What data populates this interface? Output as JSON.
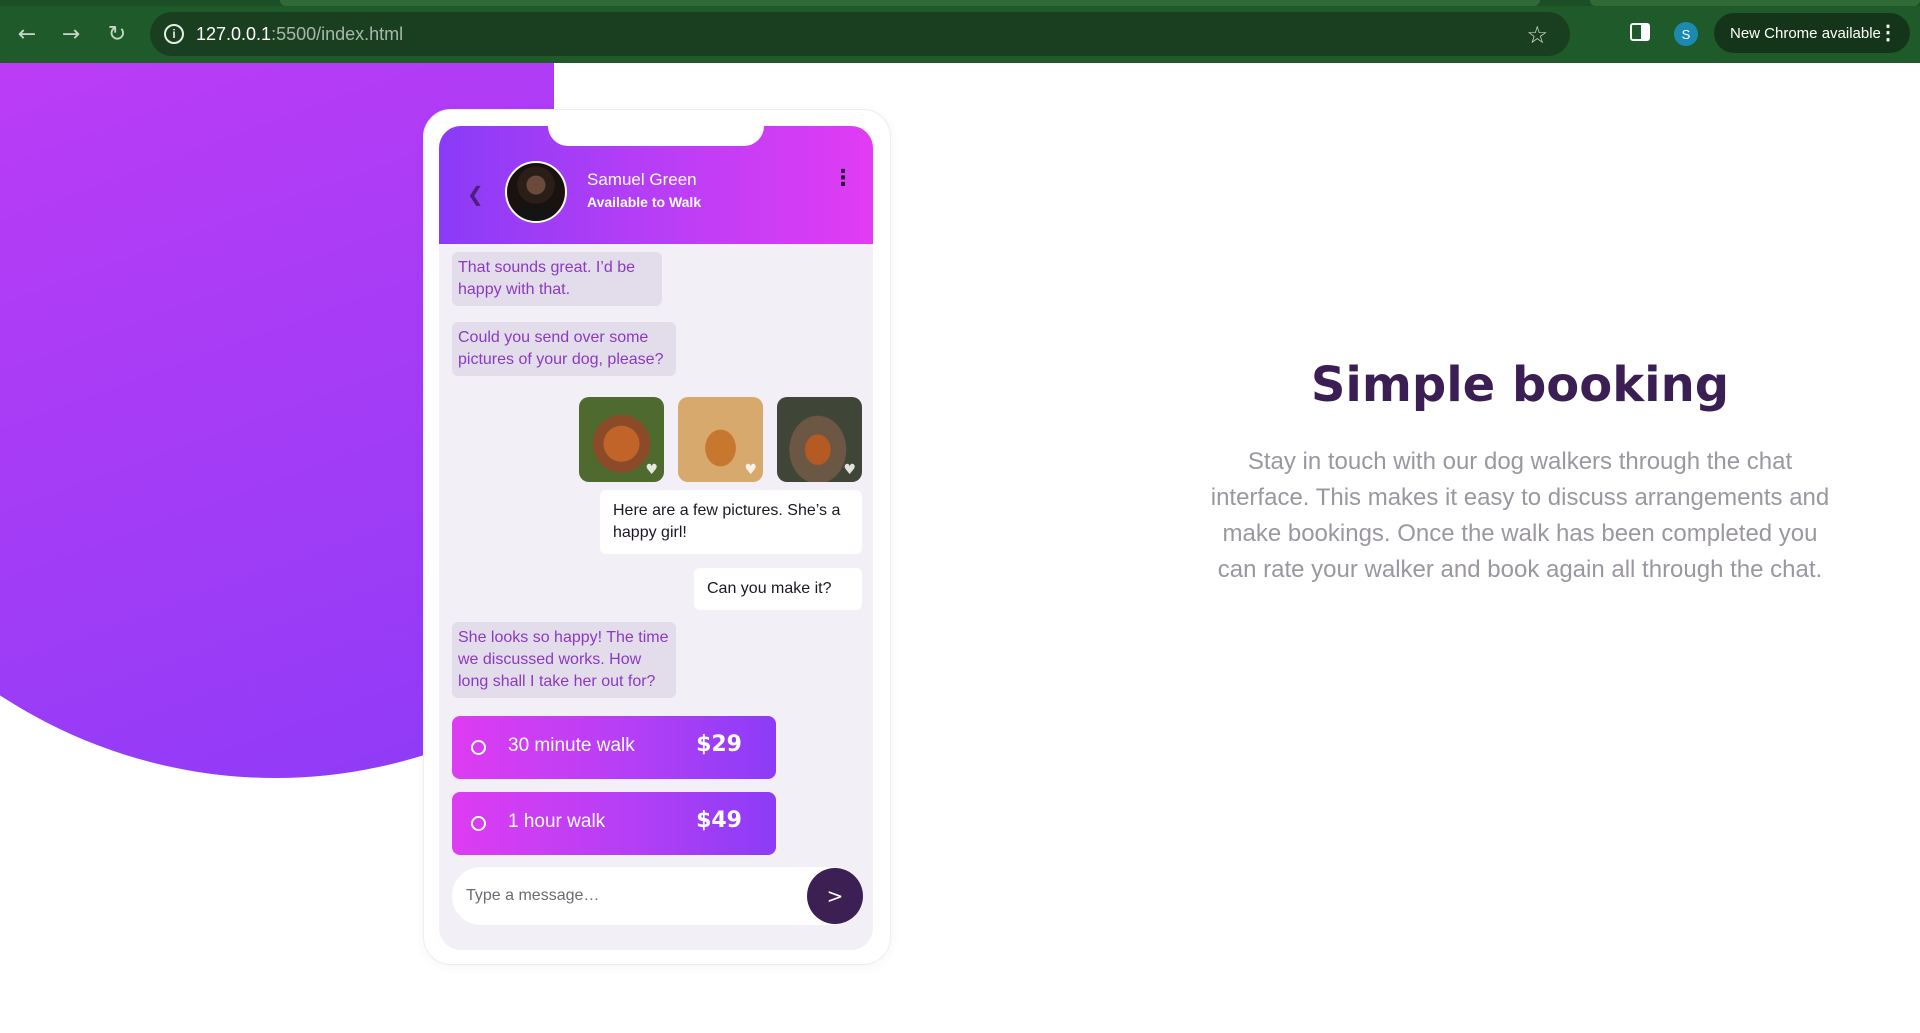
{
  "browser": {
    "url_host": "127.0.0.1",
    "url_path": ":5500/index.html",
    "profile_initial": "S",
    "update_label": "New Chrome available",
    "icons": [
      "back-icon",
      "forward-icon",
      "reload-icon",
      "info-icon",
      "star-icon",
      "side-panel-icon",
      "kebab-icon"
    ]
  },
  "chat": {
    "contact_name": "Samuel Green",
    "contact_status": "Available to Walk",
    "messages": [
      {
        "from": "walker",
        "text": "That sounds great. I’d be happy with that."
      },
      {
        "from": "walker",
        "text": "Could you send over some pictures of your dog, please?"
      },
      {
        "from": "owner",
        "text": "Here are a few pictures. She’s a happy girl!"
      },
      {
        "from": "owner",
        "text": "Can you make it?"
      },
      {
        "from": "walker",
        "text": "She looks so happy! The time we discussed works. How long shall I take her out for?"
      }
    ],
    "options": [
      {
        "label": "30 minute walk",
        "price": "$29"
      },
      {
        "label": "1 hour walk",
        "price": "$49"
      }
    ],
    "input_placeholder": "Type a message…",
    "send_symbol": ">"
  },
  "section": {
    "title": "Simple booking",
    "description": "Stay in touch with our dog walkers through the chat interface. This makes it easy to discuss arrangements and make bookings. Once the walk has been completed you can rate your walker and book again all through the chat."
  },
  "colors": {
    "brand_magenta": "#e13cf4",
    "brand_purple": "#8a3bf7",
    "dark_purple": "#3b1f54",
    "chrome_green": "#1f5b2a"
  }
}
